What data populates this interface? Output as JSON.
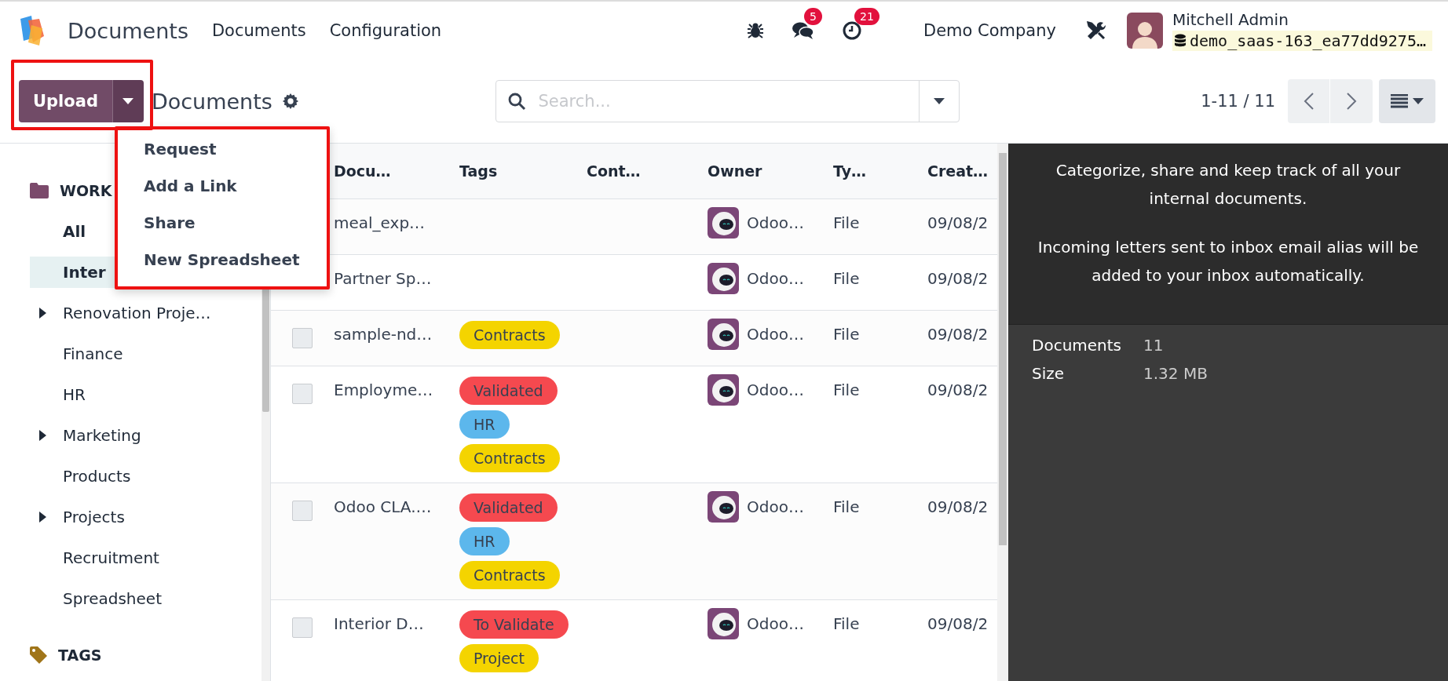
{
  "navbar": {
    "app_name": "Documents",
    "menus": [
      "Documents",
      "Configuration"
    ],
    "messages_badge": "5",
    "activities_badge": "21",
    "company": "Demo Company",
    "user_name": "Mitchell Admin",
    "database": "demo_saas-163_ea77dd9275…"
  },
  "control_panel": {
    "upload_label": "Upload",
    "breadcrumb": "Documents",
    "search": {
      "placeholder": "Search..."
    },
    "pager": "1-11 / 11"
  },
  "upload_menu": {
    "items": [
      "Request",
      "Add a Link",
      "Share",
      "New Spreadsheet"
    ]
  },
  "sidebar": {
    "sections": [
      {
        "kind": "workspace",
        "title": "WORK",
        "items": [
          {
            "label": "All",
            "selected": false,
            "caret": false
          },
          {
            "label": "Inter",
            "selected": true,
            "caret": false
          },
          {
            "label": "Renovation Proje…",
            "selected": false,
            "caret": true
          },
          {
            "label": "Finance",
            "selected": false,
            "caret": false
          },
          {
            "label": "HR",
            "selected": false,
            "caret": false
          },
          {
            "label": "Marketing",
            "selected": false,
            "caret": true
          },
          {
            "label": "Products",
            "selected": false,
            "caret": false
          },
          {
            "label": "Projects",
            "selected": false,
            "caret": true
          },
          {
            "label": "Recruitment",
            "selected": false,
            "caret": false
          },
          {
            "label": "Spreadsheet",
            "selected": false,
            "caret": false
          }
        ]
      },
      {
        "kind": "tags",
        "title": "TAGS"
      }
    ]
  },
  "table": {
    "columns": [
      "Docu…",
      "Tags",
      "Cont…",
      "Owner",
      "Ty…",
      "Creat…"
    ],
    "rows": [
      {
        "name": "meal_exp…",
        "tags": [],
        "owner": "Odoo…",
        "type": "File",
        "created": "09/08/2"
      },
      {
        "name": "Partner Sp…",
        "tags": [],
        "owner": "Odoo…",
        "type": "File",
        "created": "09/08/2"
      },
      {
        "name": "sample-nd…",
        "checked": false,
        "tags": [
          {
            "label": "Contracts",
            "color": "#f4d400"
          }
        ],
        "owner": "Odoo…",
        "type": "File",
        "created": "09/08/2"
      },
      {
        "name": "Employme…",
        "checked": false,
        "tags": [
          {
            "label": "Validated",
            "color": "#f5494f"
          },
          {
            "label": "HR",
            "color": "#5cb7ec"
          },
          {
            "label": "Contracts",
            "color": "#f4d400"
          }
        ],
        "owner": "Odoo…",
        "type": "File",
        "created": "09/08/2"
      },
      {
        "name": "Odoo CLA.…",
        "checked": false,
        "tags": [
          {
            "label": "Validated",
            "color": "#f5494f"
          },
          {
            "label": "HR",
            "color": "#5cb7ec"
          },
          {
            "label": "Contracts",
            "color": "#f4d400"
          }
        ],
        "owner": "Odoo…",
        "type": "File",
        "created": "09/08/2"
      },
      {
        "name": "Interior D…",
        "checked": false,
        "tags": [
          {
            "label": "To Validate",
            "color": "#f5494f"
          },
          {
            "label": "Project",
            "color": "#f4d400"
          }
        ],
        "owner": "Odoo…",
        "type": "File",
        "created": "09/08/2"
      }
    ]
  },
  "info_panel": {
    "paragraphs": [
      "Categorize, share and keep track of all your internal documents.",
      "Incoming letters sent to inbox email alias will be added to your inbox automatically."
    ],
    "stats": [
      {
        "label": "Documents",
        "value": "11"
      },
      {
        "label": "Size",
        "value": "1.32 MB"
      }
    ]
  }
}
